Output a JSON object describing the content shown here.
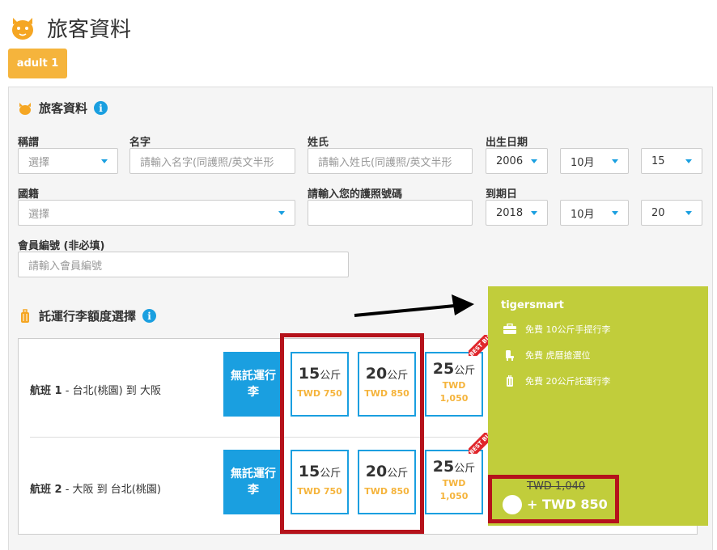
{
  "page": {
    "title": "旅客資料"
  },
  "pax_tab": {
    "label": "adult 1"
  },
  "passenger_section": {
    "title": "旅客資料"
  },
  "form": {
    "salutation": {
      "label": "稱謂",
      "value": "選擇"
    },
    "first_name": {
      "label": "名字",
      "placeholder": "請輸入名字(同護照/英文半形"
    },
    "last_name": {
      "label": "姓氏",
      "placeholder": "請輸入姓氏(同護照/英文半形"
    },
    "birth": {
      "label": "出生日期",
      "year": "2006",
      "month": "10月",
      "day": "15"
    },
    "nationality": {
      "label": "國籍",
      "value": "選擇"
    },
    "passport": {
      "label": "請輸入您的護照號碼",
      "value": ""
    },
    "expiry": {
      "label": "到期日",
      "year": "2018",
      "month": "10月",
      "day": "20"
    },
    "member_no": {
      "label": "會員編號 (非必填)",
      "placeholder": "請輸入會員編號"
    }
  },
  "baggage_section": {
    "title": "託運行李額度選擇"
  },
  "flights": [
    {
      "num": "航班 1",
      "route": " - 台北(桃園) 到 大阪",
      "no_bag": "無託運行李",
      "options": [
        {
          "kg": "15",
          "unit": "公斤",
          "price": "TWD 750"
        },
        {
          "kg": "20",
          "unit": "公斤",
          "price": "TWD 850"
        },
        {
          "kg": "25",
          "unit": "公斤",
          "price_a": "TWD",
          "price_b": "1,050"
        }
      ],
      "ribbon": "BEST BUY"
    },
    {
      "num": "航班 2",
      "route": " - 大阪 到 台北(桃園)",
      "no_bag": "無託運行李",
      "options": [
        {
          "kg": "15",
          "unit": "公斤",
          "price": "TWD 750"
        },
        {
          "kg": "20",
          "unit": "公斤",
          "price": "TWD 850"
        },
        {
          "kg": "25",
          "unit": "公斤",
          "price_a": "TWD",
          "price_b": "1,050"
        }
      ],
      "ribbon": "BEST BUY"
    }
  ],
  "tigersmart": {
    "title": "tigersmart",
    "items": [
      "免費 10公斤手提行李",
      "免費 虎暦搶選位",
      "免費 20公斤託運行李"
    ],
    "old_price": "TWD 1,040",
    "price": "+ TWD 850"
  },
  "colors": {
    "accent": "#1a9fe0",
    "orange": "#f5b43c",
    "tigersmart": "#c1cd3b",
    "highlight": "#b5121b"
  }
}
